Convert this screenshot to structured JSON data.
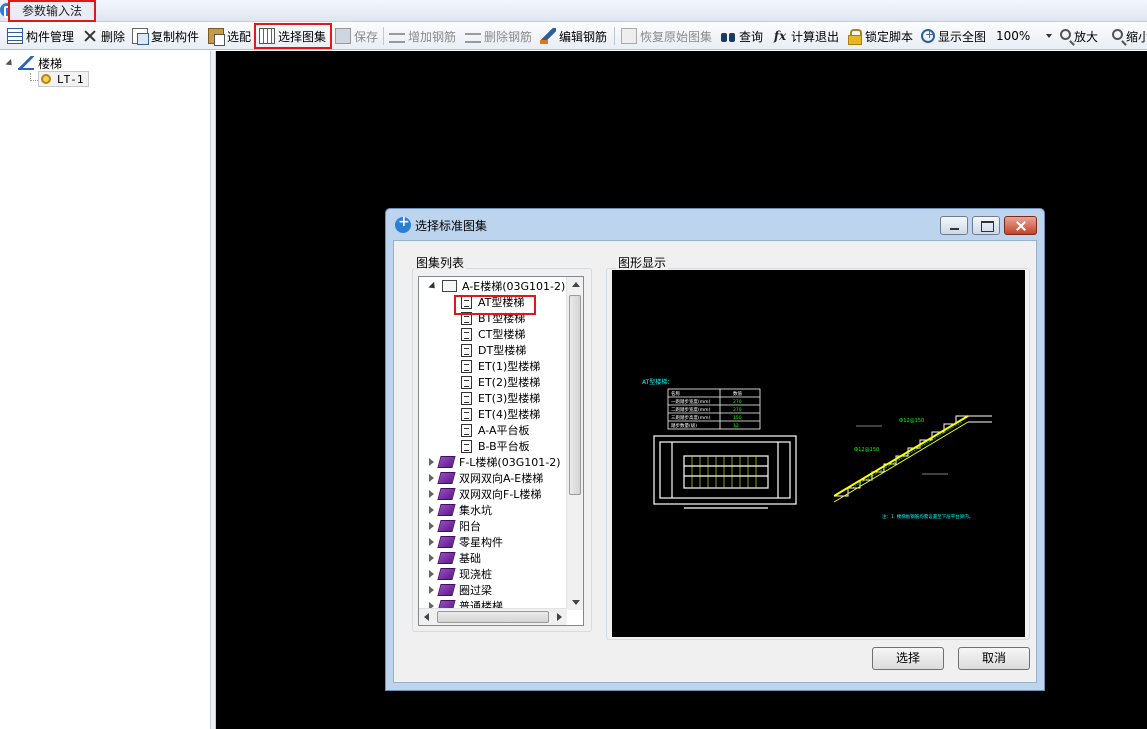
{
  "app": {
    "mode_tab": "参数输入法"
  },
  "toolbar": {
    "items": [
      {
        "label": "构件管理",
        "icon": "component-manager-icon",
        "enabled": true
      },
      {
        "label": "删除",
        "icon": "delete-x-icon",
        "enabled": true
      },
      {
        "label": "复制构件",
        "icon": "copy-icon",
        "enabled": true
      },
      {
        "label": "选配",
        "icon": "clipboard-icon",
        "enabled": true
      },
      {
        "label": "选择图集",
        "icon": "atlas-select-icon",
        "enabled": true,
        "highlighted": true
      },
      {
        "label": "保存",
        "icon": "save-icon",
        "enabled": false
      },
      {
        "label": "增加钢筋",
        "icon": "add-rebar-icon",
        "enabled": false
      },
      {
        "label": "删除钢筋",
        "icon": "delete-rebar-icon",
        "enabled": false
      },
      {
        "label": "编辑钢筋",
        "icon": "edit-rebar-icon",
        "enabled": true
      },
      {
        "label": "恢复原始图集",
        "icon": "restore-atlas-icon",
        "enabled": false
      },
      {
        "label": "查询",
        "icon": "binoculars-icon",
        "enabled": true
      },
      {
        "label": "计算退出",
        "icon": "fx-icon",
        "enabled": true
      },
      {
        "label": "锁定脚本",
        "icon": "lock-icon",
        "enabled": true
      },
      {
        "label": "显示全图",
        "icon": "zoom-fit-icon",
        "enabled": true
      },
      {
        "label": "放大",
        "icon": "zoom-in-icon",
        "enabled": true
      },
      {
        "label": "缩小",
        "icon": "zoom-out-icon",
        "enabled": true
      }
    ],
    "zoom_value": "100%"
  },
  "tree": {
    "root_label": "楼梯",
    "child_label": "LT-1"
  },
  "dialog": {
    "title": "选择标准图集",
    "list_group_label": "图集列表",
    "preview_group_label": "图形显示",
    "list": [
      {
        "label": "A-E楼梯(03G101-2)",
        "type": "folder-open",
        "level": 0
      },
      {
        "label": "AT型楼梯",
        "type": "doc",
        "level": 1,
        "selected": true
      },
      {
        "label": "BT型楼梯",
        "type": "doc",
        "level": 1
      },
      {
        "label": "CT型楼梯",
        "type": "doc",
        "level": 1
      },
      {
        "label": "DT型楼梯",
        "type": "doc",
        "level": 1
      },
      {
        "label": "ET(1)型楼梯",
        "type": "doc",
        "level": 1
      },
      {
        "label": "ET(2)型楼梯",
        "type": "doc",
        "level": 1
      },
      {
        "label": "ET(3)型楼梯",
        "type": "doc",
        "level": 1
      },
      {
        "label": "ET(4)型楼梯",
        "type": "doc",
        "level": 1
      },
      {
        "label": "A-A平台板",
        "type": "doc",
        "level": 1
      },
      {
        "label": "B-B平台板",
        "type": "doc",
        "level": 1
      },
      {
        "label": "F-L楼梯(03G101-2)",
        "type": "folder",
        "level": 0
      },
      {
        "label": "双网双向A-E楼梯",
        "type": "folder",
        "level": 0
      },
      {
        "label": "双网双向F-L楼梯",
        "type": "folder",
        "level": 0
      },
      {
        "label": "集水坑",
        "type": "folder",
        "level": 0
      },
      {
        "label": "阳台",
        "type": "folder",
        "level": 0
      },
      {
        "label": "零星构件",
        "type": "folder",
        "level": 0
      },
      {
        "label": "基础",
        "type": "folder",
        "level": 0
      },
      {
        "label": "现浇桩",
        "type": "folder",
        "level": 0
      },
      {
        "label": "圈过梁",
        "type": "folder",
        "level": 0
      },
      {
        "label": "普通楼梯",
        "type": "folder",
        "level": 0
      }
    ],
    "preview": {
      "title": "AT型楼梯：",
      "note": "注：1. 楼梯板钢筋均需设置至下层平台梁内。",
      "rebar_top": "Ф12@150",
      "rebar_bottom": "Ф12@150",
      "params_table": [
        [
          "名称",
          "数值"
        ],
        [
          "一跑踏步宽度(mm)",
          "270"
        ],
        [
          "二跑踏步宽度(mm)",
          "270"
        ],
        [
          "三跑踏步高度(mm)",
          "150"
        ],
        [
          "踏步数量(级)",
          "12"
        ]
      ]
    },
    "buttons": {
      "select": "选择",
      "cancel": "取消"
    }
  },
  "colors": {
    "highlight": "#e01818",
    "canvas": "#000000",
    "cad_white": "#ffffff",
    "cad_yellow": "#ffff00",
    "cad_cyan": "#00ffff",
    "cad_green": "#00ff00"
  }
}
